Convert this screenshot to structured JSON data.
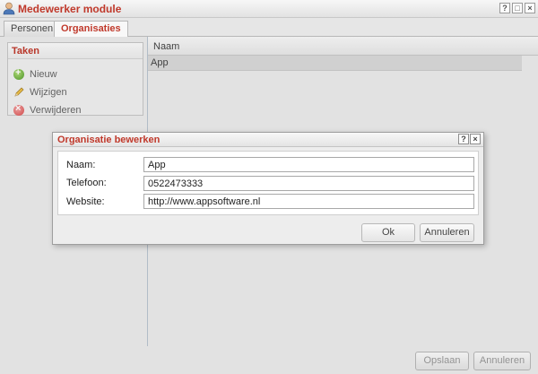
{
  "window": {
    "title": "Medewerker module",
    "icon": "user-icon",
    "controls": [
      "help-icon",
      "maximize-icon",
      "close-icon"
    ]
  },
  "tabs": [
    {
      "label": "Personen",
      "active": false
    },
    {
      "label": "Organisaties",
      "active": true
    }
  ],
  "tasks": {
    "header": "Taken",
    "items": [
      {
        "label": "Nieuw",
        "icon": "add-icon"
      },
      {
        "label": "Wijzigen",
        "icon": "edit-pencil-icon"
      },
      {
        "label": "Verwijderen",
        "icon": "delete-icon"
      }
    ]
  },
  "grid": {
    "columns": [
      "Naam"
    ],
    "rows": [
      [
        "App"
      ]
    ]
  },
  "footer": {
    "save_label": "Opslaan",
    "cancel_label": "Annuleren"
  },
  "dialog": {
    "title": "Organisatie bewerken",
    "fields": [
      {
        "label": "Naam:",
        "value": "App"
      },
      {
        "label": "Telefoon:",
        "value": "0522473333"
      },
      {
        "label": "Website:",
        "value": "http://www.appsoftware.nl"
      }
    ],
    "ok_label": "Ok",
    "cancel_label": "Annuleren"
  },
  "colors": {
    "accent": "#c0392b",
    "selected_row": "#d9d9d9"
  }
}
